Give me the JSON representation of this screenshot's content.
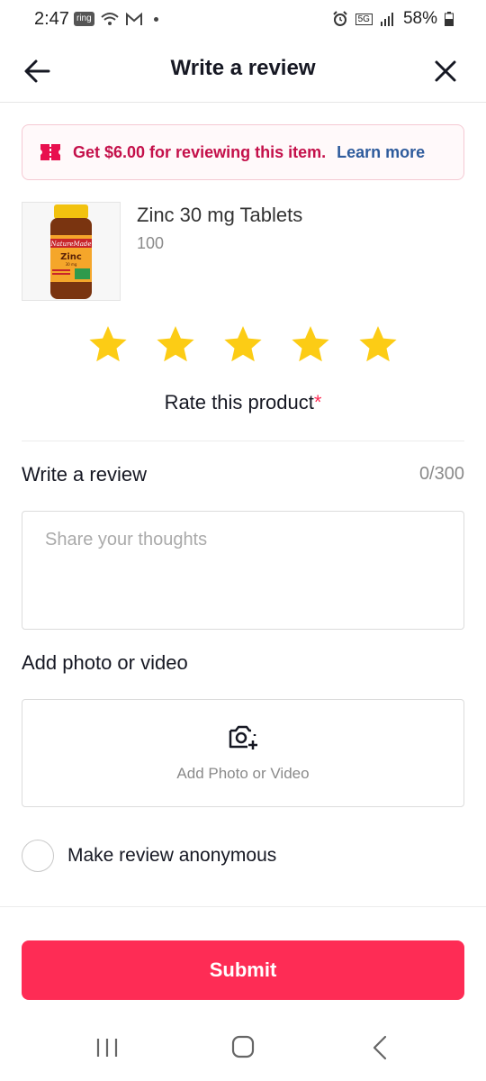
{
  "status_bar": {
    "time": "2:47",
    "ring_label": "ring",
    "network_label": "5G",
    "battery": "58%"
  },
  "nav": {
    "title": "Write a review"
  },
  "promo": {
    "text": "Get $6.00 for reviewing this item.",
    "link": "Learn more",
    "icon": "ticket-icon"
  },
  "product": {
    "name": "Zinc 30 mg Tablets",
    "quantity": "100",
    "thumb": {
      "brand": "NatureMade",
      "label": "Zinc",
      "dose": "30 mg"
    }
  },
  "rating": {
    "star_count": 5,
    "label": "Rate this product",
    "required_mark": "*"
  },
  "review": {
    "label": "Write a review",
    "count": "0/300",
    "placeholder": "Share your thoughts"
  },
  "media": {
    "label": "Add photo or video",
    "button_text": "Add Photo or Video"
  },
  "anonymous": {
    "label": "Make review anonymous"
  },
  "submit": {
    "label": "Submit"
  },
  "colors": {
    "accent": "#fe2c55",
    "promo_text": "#c4104a",
    "link": "#2e5b9c",
    "star": "#fccc15"
  }
}
